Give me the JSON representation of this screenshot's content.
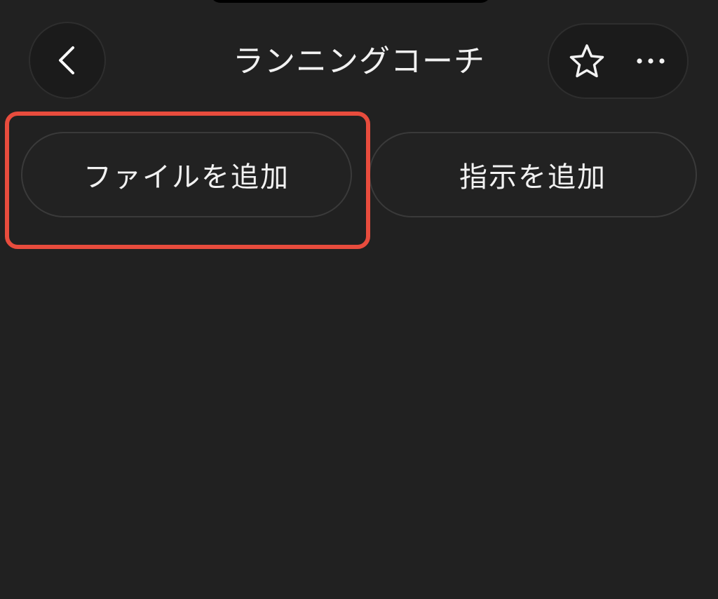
{
  "header": {
    "title": "ランニングコーチ",
    "back_icon": "chevron-left-icon",
    "favorite_icon": "star-icon",
    "more_icon": "more-horizontal-icon"
  },
  "actions": {
    "add_file_label": "ファイルを追加",
    "add_instruction_label": "指示を追加"
  },
  "colors": {
    "background": "#212121",
    "highlight": "#e84c3d",
    "text": "#f2f2f2"
  }
}
